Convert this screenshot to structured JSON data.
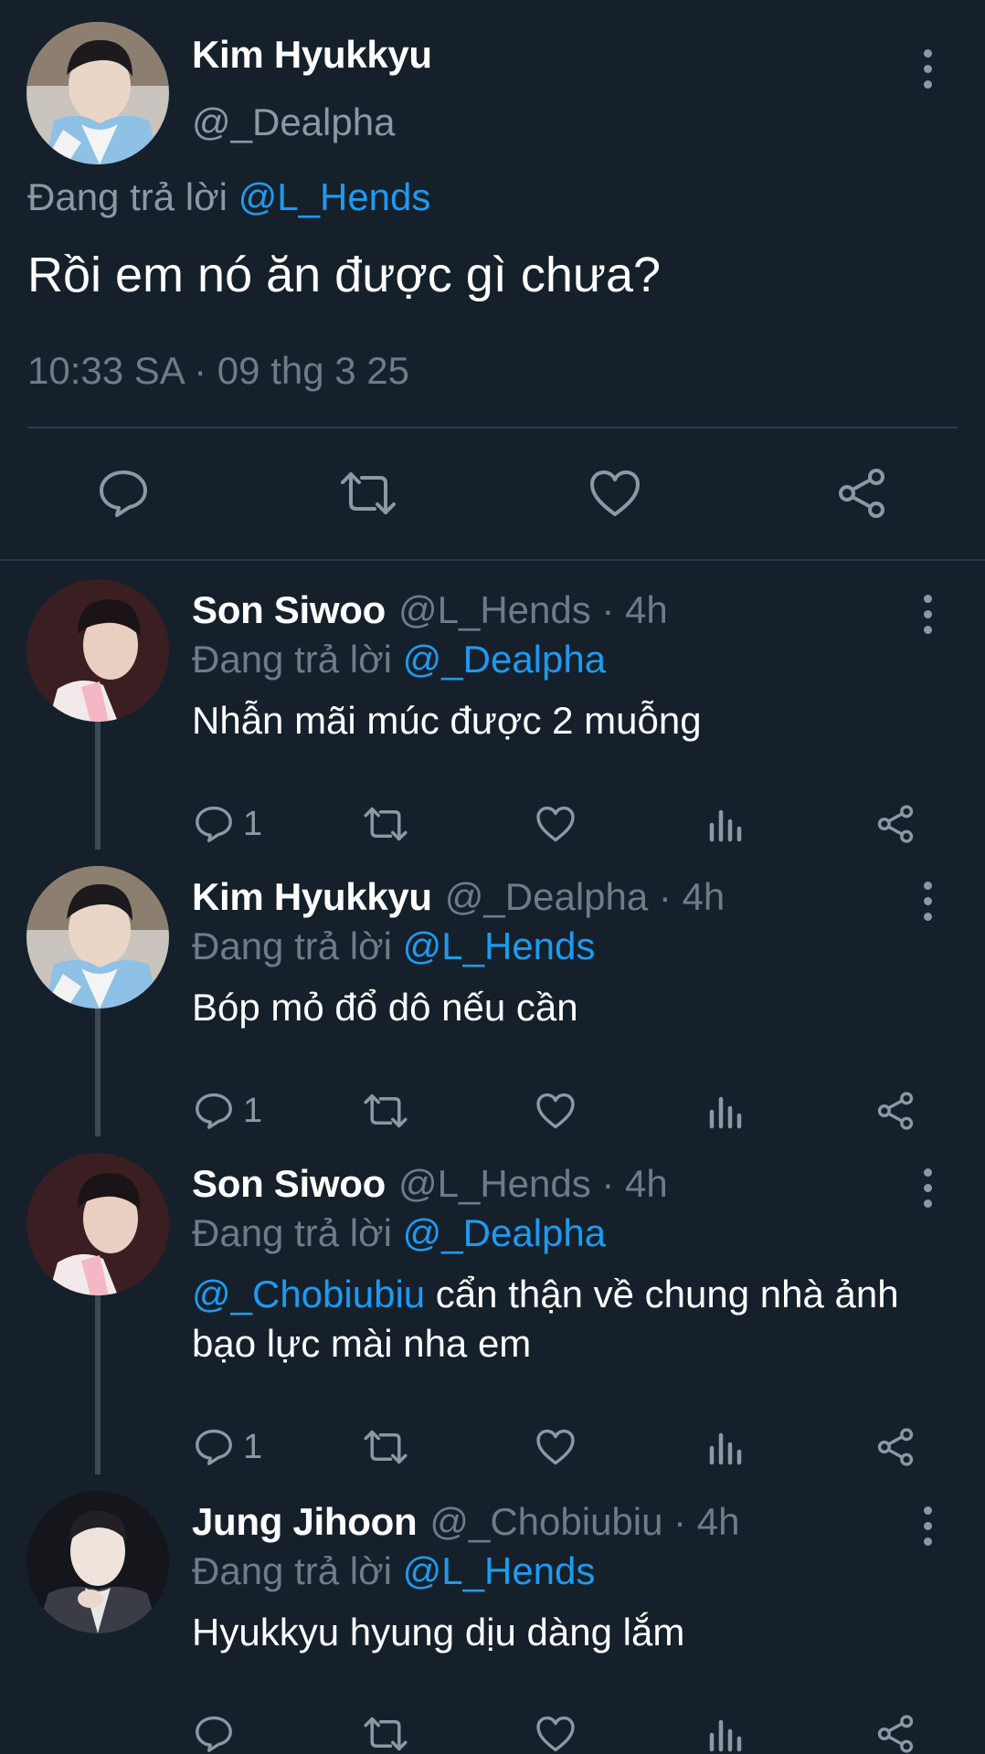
{
  "main": {
    "name": "Kim Hyukkyu",
    "handle": "@_Dealpha",
    "replying_prefix": "Đang trả lời",
    "replying_to": "@L_Hends",
    "text": "Rồi em nó ăn được gì chưa?",
    "timestamp": "10:33 SA · 09 thg 3 25"
  },
  "replies": [
    {
      "name": "Son Siwoo",
      "meta": "@L_Hends · 4h",
      "replying_prefix": "Đang trả lời",
      "replying_to": "@_Dealpha",
      "mention": "",
      "text": "Nhẫn mãi múc được 2 muỗng",
      "reply_count": "1"
    },
    {
      "name": "Kim Hyukkyu",
      "meta": "@_Dealpha · 4h",
      "replying_prefix": "Đang trả lời",
      "replying_to": "@L_Hends",
      "mention": "",
      "text": "Bóp mỏ đổ dô nếu cần",
      "reply_count": "1"
    },
    {
      "name": "Son Siwoo",
      "meta": "@L_Hends · 4h",
      "replying_prefix": "Đang trả lời",
      "replying_to": "@_Dealpha",
      "mention": "@_Chobiubiu",
      "text": " cẩn thận về chung nhà ảnh bạo lực mài nha em",
      "reply_count": "1"
    },
    {
      "name": "Jung Jihoon",
      "meta": "@_Chobiubiu · 4h",
      "replying_prefix": "Đang trả lời",
      "replying_to": "@L_Hends",
      "mention": "",
      "text": "Hyukkyu hyung dịu dàng lắm",
      "reply_count": ""
    }
  ],
  "icons": {
    "reply": "comment-icon",
    "retweet": "retweet-icon",
    "like": "heart-icon",
    "analytics": "analytics-icon",
    "share": "share-icon",
    "more": "more-vertical-icon"
  },
  "colors": {
    "background": "#15202b",
    "link": "#1d9bf0",
    "secondary_text": "#8b98a5",
    "divider": "#2f3b47"
  }
}
